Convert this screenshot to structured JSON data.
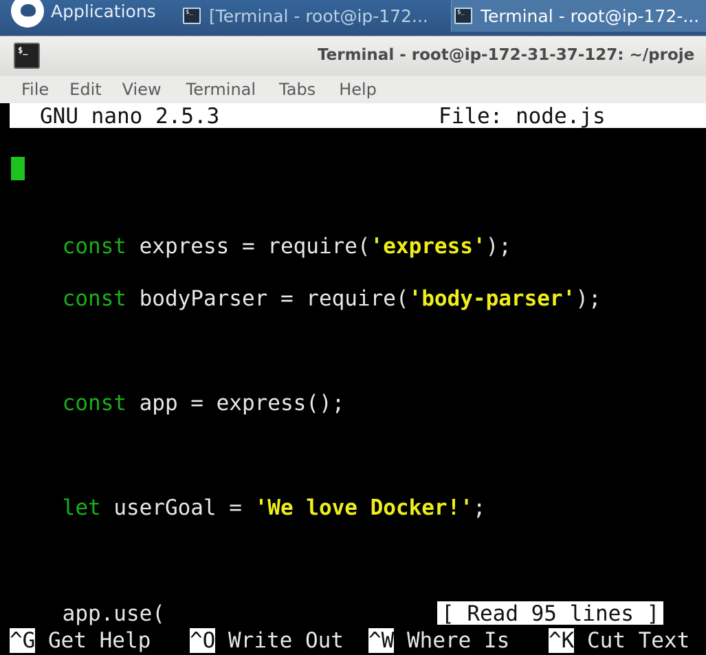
{
  "taskbar": {
    "applications_label": "Applications",
    "tasks": [
      {
        "label": "[Terminal - root@ip-172..."
      },
      {
        "label": "Terminal - root@ip-172-..."
      }
    ]
  },
  "window": {
    "title": "Terminal - root@ip-172-31-37-127: ~/proje"
  },
  "menu": [
    "File",
    "Edit",
    "View",
    "Terminal",
    "Tabs",
    "Help"
  ],
  "nano": {
    "version": "GNU nano 2.5.3",
    "file_label": "File: node.js",
    "status_message": "[ Read 95 lines ]",
    "code": {
      "l1_kw": "const",
      "l1_a": " express = require(",
      "l1_str": "'express'",
      "l1_b": ");",
      "l2_kw": "const",
      "l2_a": " bodyParser = require(",
      "l2_str": "'body-parser'",
      "l2_b": ");",
      "l3_kw": "const",
      "l3_a": " app = express();",
      "l4_kw": "let",
      "l4_a": " userGoal = ",
      "l4_str": "'We love Docker!'",
      "l4_b": ";",
      "l5_a": "app.use("
    },
    "shortcuts": [
      {
        "key": "^G",
        "label": " Get Help"
      },
      {
        "key": "^O",
        "label": " Write Out"
      },
      {
        "key": "^W",
        "label": " Where Is"
      },
      {
        "key": "^K",
        "label": " Cut Text"
      }
    ]
  },
  "colors": {
    "keyword": "#19b019",
    "string": "#eeee1a",
    "cursor": "#1ec21e",
    "taskbar": "#2c5382"
  }
}
